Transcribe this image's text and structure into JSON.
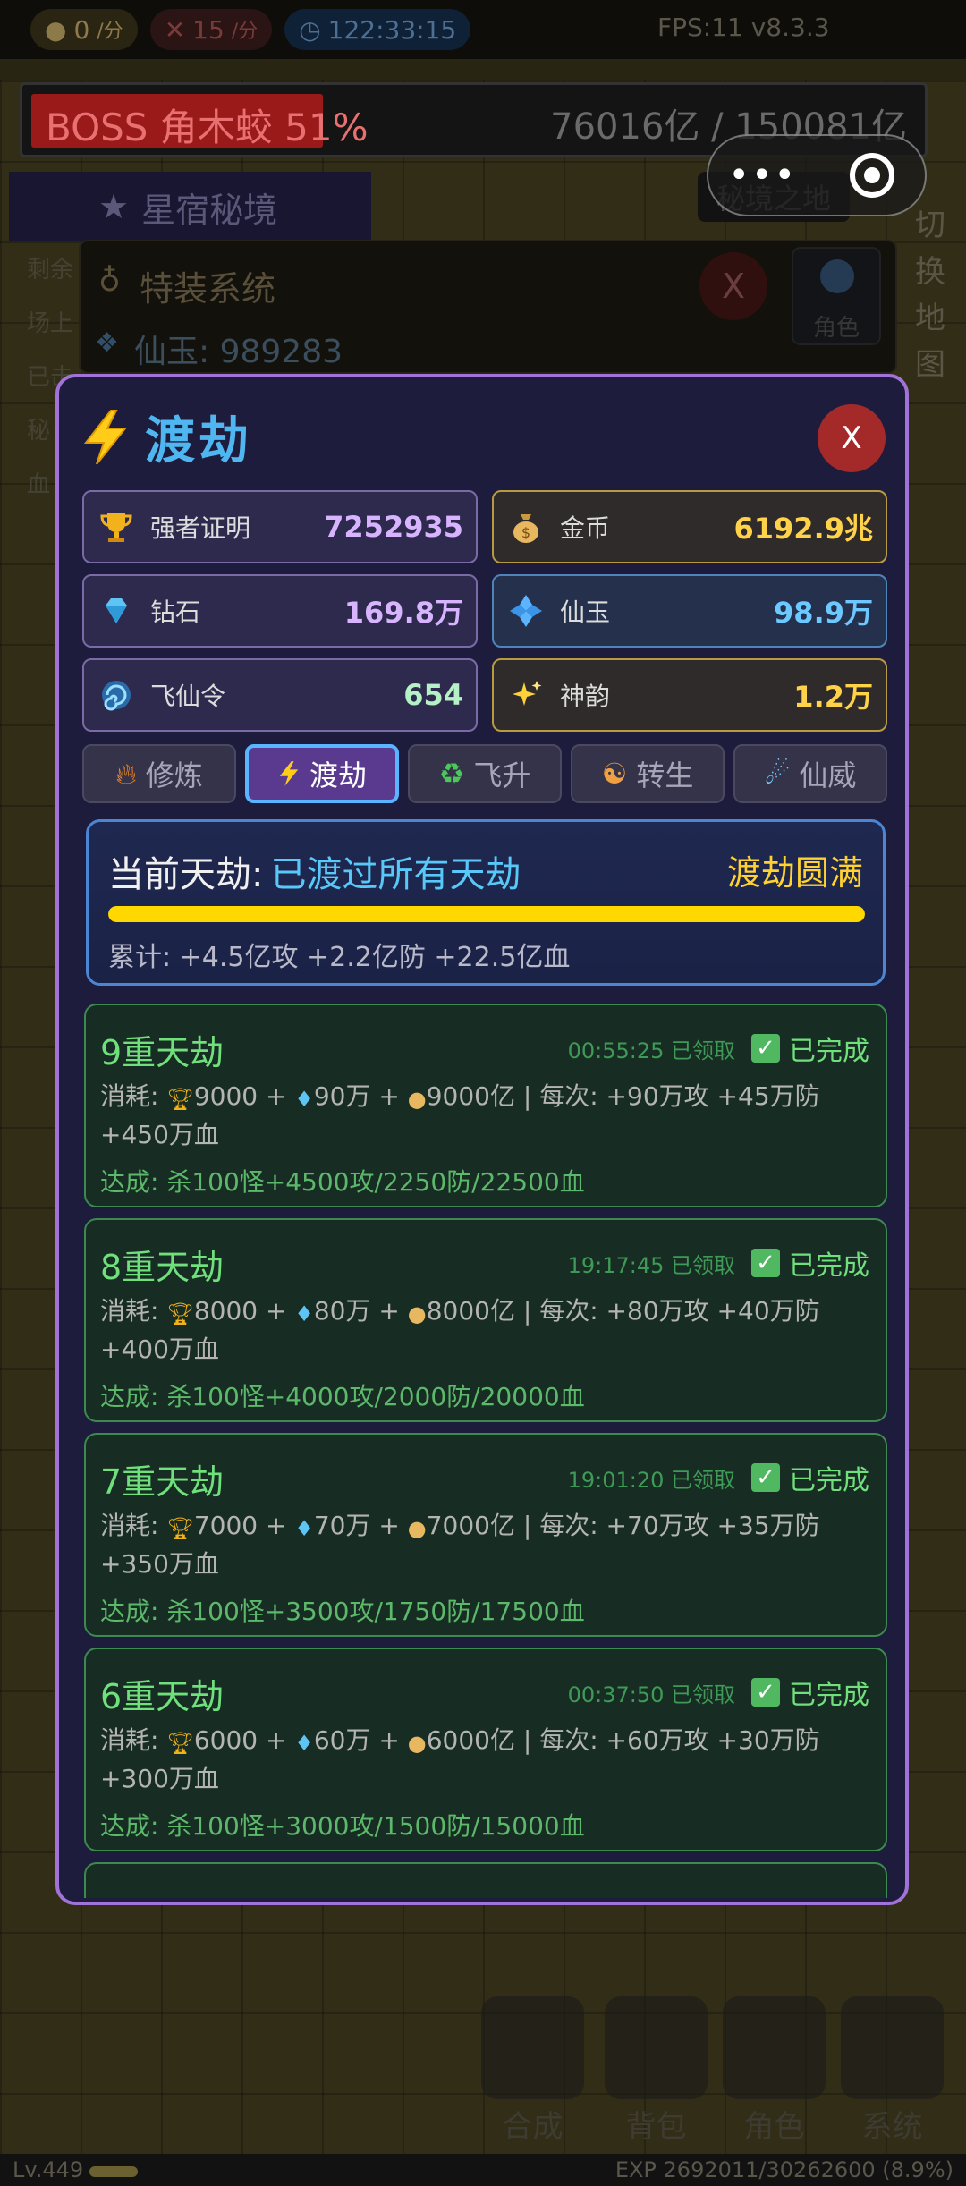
{
  "topbar": {
    "gold_rate": "0",
    "gold_unit": "/分",
    "kill_rate": "15",
    "kill_unit": "/分",
    "timer": "122:33:15",
    "fps": "FPS:11  v8.3.3"
  },
  "boss": {
    "label": "BOSS 角木蛟 51%",
    "hp_percent": 51,
    "hp_text": "76016亿 / 150081亿"
  },
  "background": {
    "star_tab": "星宿秘境",
    "secret_tag": "秘境之地",
    "side_switch": [
      "切",
      "换",
      "地",
      "图"
    ],
    "left_labels": [
      "剩余",
      "场上",
      "已击",
      "秘",
      "血"
    ],
    "special_panel_title": "特装系统",
    "special_panel_value": "仙玉: 989283",
    "special_panel_close": "X",
    "role_button": "角色",
    "bottom_nav": [
      "合成",
      "背包",
      "角色",
      "系统"
    ],
    "level": "Lv.449",
    "exp": "EXP 2692011/30262600 (8.9%)"
  },
  "modal": {
    "title": "渡劫",
    "close_label": "X",
    "resources": [
      {
        "label": "强者证明",
        "value": "7252935",
        "style": "purple",
        "icon": "trophy-icon"
      },
      {
        "label": "金币",
        "value": "6192.9兆",
        "style": "gold",
        "icon": "money-bag-icon"
      },
      {
        "label": "钻石",
        "value": "169.8万",
        "style": "purple",
        "icon": "diamond-icon"
      },
      {
        "label": "仙玉",
        "value": "98.9万",
        "style": "blue",
        "icon": "jade-icon"
      },
      {
        "label": "飞仙令",
        "value": "654",
        "style": "purple",
        "icon": "swirl-icon"
      },
      {
        "label": "神韵",
        "value": "1.2万",
        "style": "gold",
        "icon": "sparkle-icon"
      }
    ],
    "tabs": [
      {
        "label": "修炼",
        "icon": "fire-icon",
        "active": false
      },
      {
        "label": "渡劫",
        "icon": "bolt-icon",
        "active": true
      },
      {
        "label": "飞升",
        "icon": "recycle-icon",
        "active": false
      },
      {
        "label": "转生",
        "icon": "meditate-icon",
        "active": false
      },
      {
        "label": "仙威",
        "icon": "comet-icon",
        "active": false
      }
    ],
    "status": {
      "label": "当前天劫:",
      "value": "已渡过所有天劫",
      "full_label": "渡劫圆满",
      "progress": 1.0,
      "total": "累计: +4.5亿攻 +2.2亿防 +22.5亿血"
    },
    "tribulations": [
      {
        "name": "9重天劫",
        "time": "00:55:25 已领取",
        "done": "已完成",
        "cost_prefix": "消耗: ",
        "trophy": "9000",
        "diamond": "90万",
        "gold": "9000亿",
        "per": "每次: +90万攻 +45万防 +450万血",
        "reach": "达成: 杀100怪+4500攻/2250防/22500血"
      },
      {
        "name": "8重天劫",
        "time": "19:17:45 已领取",
        "done": "已完成",
        "cost_prefix": "消耗: ",
        "trophy": "8000",
        "diamond": "80万",
        "gold": "8000亿",
        "per": "每次: +80万攻 +40万防 +400万血",
        "reach": "达成: 杀100怪+4000攻/2000防/20000血"
      },
      {
        "name": "7重天劫",
        "time": "19:01:20 已领取",
        "done": "已完成",
        "cost_prefix": "消耗: ",
        "trophy": "7000",
        "diamond": "70万",
        "gold": "7000亿",
        "per": "每次: +70万攻 +35万防 +350万血",
        "reach": "达成: 杀100怪+3500攻/1750防/17500血"
      },
      {
        "name": "6重天劫",
        "time": "00:37:50 已领取",
        "done": "已完成",
        "cost_prefix": "消耗: ",
        "trophy": "6000",
        "diamond": "60万",
        "gold": "6000亿",
        "per": "每次: +60万攻 +30万防 +300万血",
        "reach": "达成: 杀100怪+3000攻/1500防/15000血"
      }
    ]
  },
  "colors": {
    "modal_border": "#a173d8",
    "title_blue": "#4fb6f0",
    "done_green": "#6fe07c",
    "progress_yellow": "#ffd800"
  }
}
